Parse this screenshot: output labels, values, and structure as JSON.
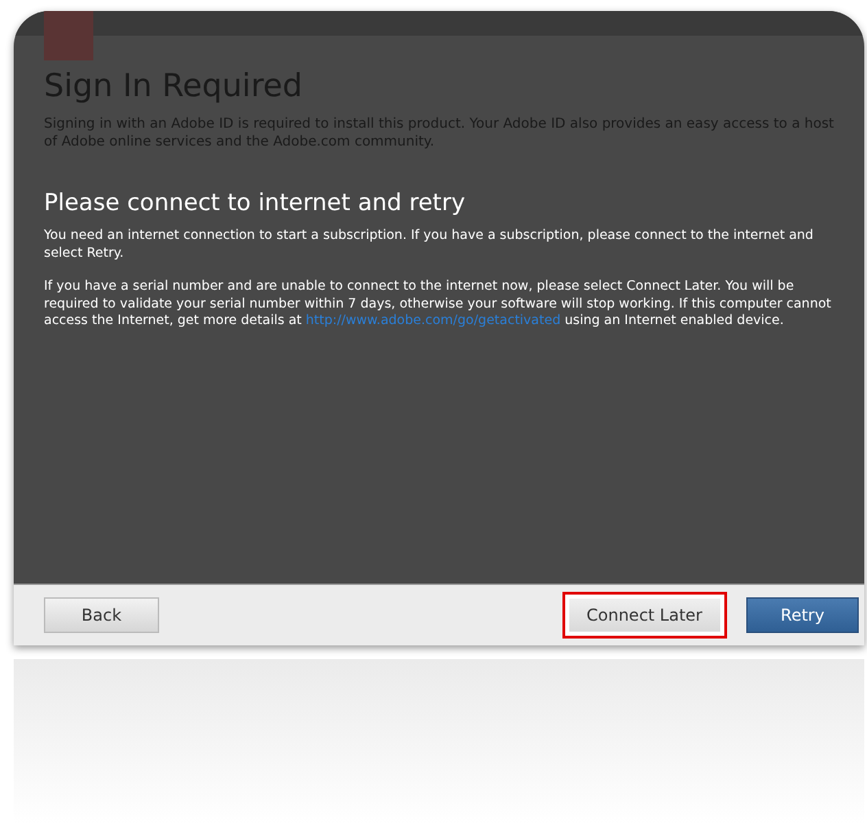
{
  "background": {
    "title": "Sign In Required",
    "text": "Signing in with an Adobe ID is required to install this product. Your Adobe ID also provides an easy access to a host of Adobe online services and the Adobe.com community."
  },
  "message": {
    "heading": "Please connect to internet and retry",
    "paragraphs": [
      "You need an internet connection to start a subscription. If you have a subscription, please connect to the internet and select Retry."
    ],
    "serial_text_before": "If you have a serial number and are unable to connect to the internet now, please select Connect Later. You will be required to validate your serial number within 7 days, otherwise your software will stop working. If this computer cannot access the Internet, get more details at ",
    "link": "http://www.adobe.com/go/getactivated",
    "serial_text_after": " using an Internet enabled device."
  },
  "buttons": [
    {
      "label": "Back",
      "kind": "secondary",
      "highlighted": false
    },
    {
      "label": "Connect Later",
      "kind": "secondary",
      "highlighted": true
    },
    {
      "label": "Retry",
      "kind": "primary",
      "highlighted": false
    }
  ]
}
